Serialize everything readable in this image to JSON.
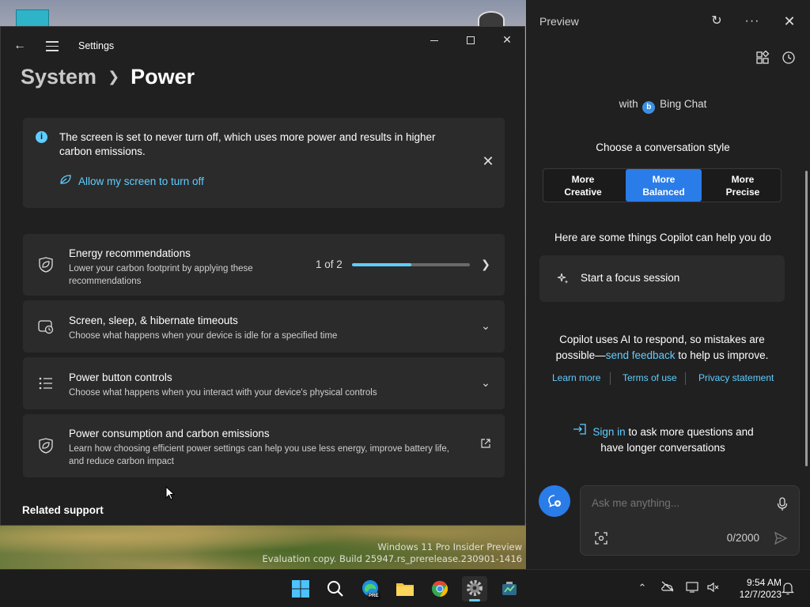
{
  "desktop": {
    "watermark_line1": "Windows 11 Pro Insider Preview",
    "watermark_line2": "Evaluation copy. Build 25947.rs_prerelease.230901-1416"
  },
  "settings": {
    "window_title": "Settings",
    "breadcrumb_parent": "System",
    "breadcrumb_current": "Power",
    "info_banner": {
      "text": "The screen is set to never turn off, which uses more power and results in higher carbon emissions.",
      "action": "Allow my screen to turn off"
    },
    "cards": {
      "energy": {
        "title": "Energy recommendations",
        "description": "Lower your carbon footprint by applying these recommendations",
        "progress_text": "1 of 2",
        "progress_fraction": 0.5
      },
      "screen": {
        "title": "Screen, sleep, & hibernate timeouts",
        "description": "Choose what happens when your device is idle for a specified time"
      },
      "power_button": {
        "title": "Power button controls",
        "description": "Choose what happens when you interact with your device's physical controls"
      },
      "consumption": {
        "title": "Power consumption and carbon emissions",
        "description": "Learn how choosing efficient power settings can help you use less energy, improve battery life, and reduce carbon impact"
      }
    },
    "related_support": "Related support"
  },
  "copilot": {
    "pane_title": "Preview",
    "with_prefix": "with",
    "bing_chat": "Bing Chat",
    "style_heading": "Choose a conversation style",
    "styles": [
      {
        "line1": "More",
        "line2": "Creative",
        "selected": false
      },
      {
        "line1": "More",
        "line2": "Balanced",
        "selected": true
      },
      {
        "line1": "More",
        "line2": "Precise",
        "selected": false
      }
    ],
    "help_heading": "Here are some things Copilot can help you do",
    "suggestion": "Start a focus session",
    "disclaimer_before": "Copilot uses AI to respond, so mistakes are possible—",
    "disclaimer_link": "send feedback",
    "disclaimer_after": " to help us improve.",
    "links": [
      "Learn more",
      "Terms of use",
      "Privacy statement"
    ],
    "signin_link": "Sign in",
    "signin_rest_1": " to ask more questions and",
    "signin_rest_2": "have longer conversations",
    "input_placeholder": "Ask me anything...",
    "char_count": "0/2000",
    "accent_color": "#2a7ce8"
  },
  "taskbar": {
    "time": "9:54 AM",
    "date": "12/7/2023",
    "edge_badge": "PRE"
  }
}
